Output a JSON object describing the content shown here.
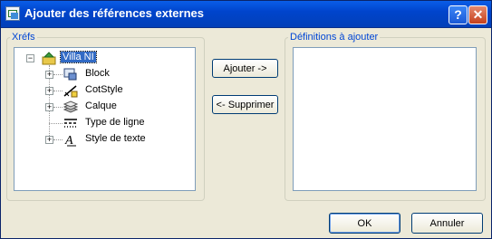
{
  "window": {
    "title": "Ajouter des références externes",
    "help_glyph": "?",
    "close_glyph": "✕"
  },
  "left_group": {
    "legend": "Xréfs",
    "tree": {
      "root": {
        "label": "Villa NI",
        "expanded": true,
        "selected": true
      },
      "children": [
        {
          "label": "Block",
          "icon": "block-icon",
          "expandable": true
        },
        {
          "label": "CotStyle",
          "icon": "dimstyle-icon",
          "expandable": true
        },
        {
          "label": "Calque",
          "icon": "layers-icon",
          "expandable": true
        },
        {
          "label": "Type de ligne",
          "icon": "linetype-icon",
          "expandable": false
        },
        {
          "label": "Style de texte",
          "icon": "textstyle-icon",
          "expandable": true
        }
      ]
    }
  },
  "right_group": {
    "legend": "Définitions à ajouter",
    "items": []
  },
  "buttons": {
    "add": "Ajouter ->",
    "remove": "<- Supprimer",
    "ok": "OK",
    "cancel": "Annuler"
  }
}
